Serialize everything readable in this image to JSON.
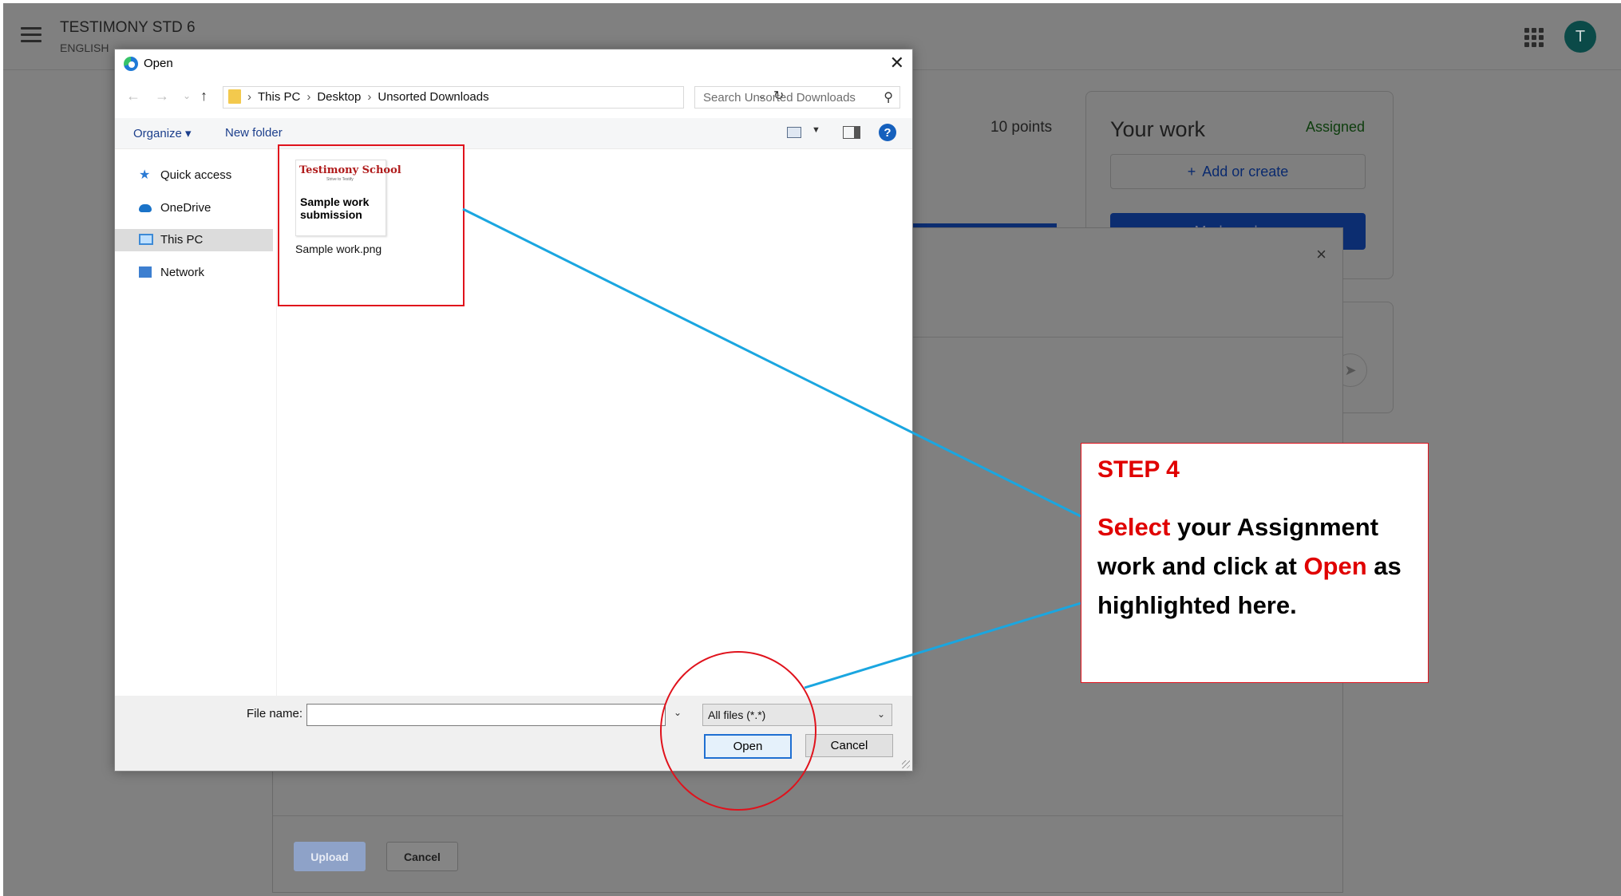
{
  "classroom": {
    "class_title": "TESTIMONY STD 6",
    "class_subject": "ENGLISH",
    "avatar_letter": "T",
    "points": "10 points",
    "your_work": {
      "title": "Your work",
      "status": "Assigned",
      "add_label": "Add or create",
      "add_icon": "+",
      "mark_done_label": "Mark as done"
    },
    "upload_panel": {
      "close_glyph": "×",
      "upload_label": "Upload",
      "cancel_label": "Cancel"
    }
  },
  "dialog": {
    "title": "Open",
    "close_glyph": "✕",
    "breadcrumb": [
      "This PC",
      "Desktop",
      "Unsorted Downloads"
    ],
    "search_placeholder": "Search Unsorted Downloads",
    "organize_label": "Organize ▾",
    "new_folder_label": "New folder",
    "nav_items": [
      {
        "label": "Quick access",
        "icon": "star-icon"
      },
      {
        "label": "OneDrive",
        "icon": "cloud-icon"
      },
      {
        "label": "This PC",
        "icon": "computer-icon",
        "selected": true
      },
      {
        "label": "Network",
        "icon": "network-icon"
      }
    ],
    "files": [
      {
        "name": "Sample work.png",
        "thumb_logo": "Testimony School",
        "thumb_tagline": "Strive to Testify",
        "thumb_text": "Sample work submission"
      }
    ],
    "file_name_label": "File name:",
    "file_name_value": "",
    "file_type": "All files (*.*)",
    "open_label": "Open",
    "cancel_label": "Cancel"
  },
  "callout": {
    "step": "STEP 4",
    "select_word": "Select",
    "text_part1": " your Assignment work and click at ",
    "open_word": "Open",
    "text_part2": " as highlighted here."
  },
  "colors": {
    "highlight": "#e0121c",
    "connector": "#1aa6e0",
    "callout_accent": "#e00000",
    "dim_overlay": "#808080"
  }
}
